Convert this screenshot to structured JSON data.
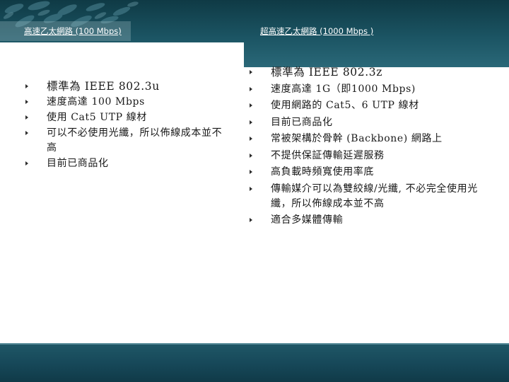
{
  "header": {
    "left_title": "高速乙太網路 (100 Mbps)",
    "right_title": "超高速乙太網路 (1000 Mbps )"
  },
  "left_column": {
    "items": [
      "標準為 IEEE 802.3u",
      "速度高達 100 Mbps",
      "使用 Cat5 UTP 線材",
      "可以不必使用光纖，所以佈線成本並不高",
      "目前已商品化"
    ]
  },
  "right_column": {
    "items": [
      "標準為 IEEE 802.3z",
      "速度高達 1G（即1000 Mbps)",
      "使用網路的 Cat5、6 UTP 線材",
      "目前已商品化",
      "常被架構於骨幹 (Backbone) 網路上",
      "不提供保証傳輸延遲服務",
      "高負載時頻寬使用率底",
      "傳輸媒介可以為雙絞線/光纖, 不必完全使用光纖，所以佈線成本並不高",
      "適合多媒體傳輸"
    ]
  },
  "colors": {
    "header_band": "#1b5463",
    "footer_band": "#17495a",
    "body_text": "#1a1a1a",
    "title_text": "#ffffff"
  }
}
